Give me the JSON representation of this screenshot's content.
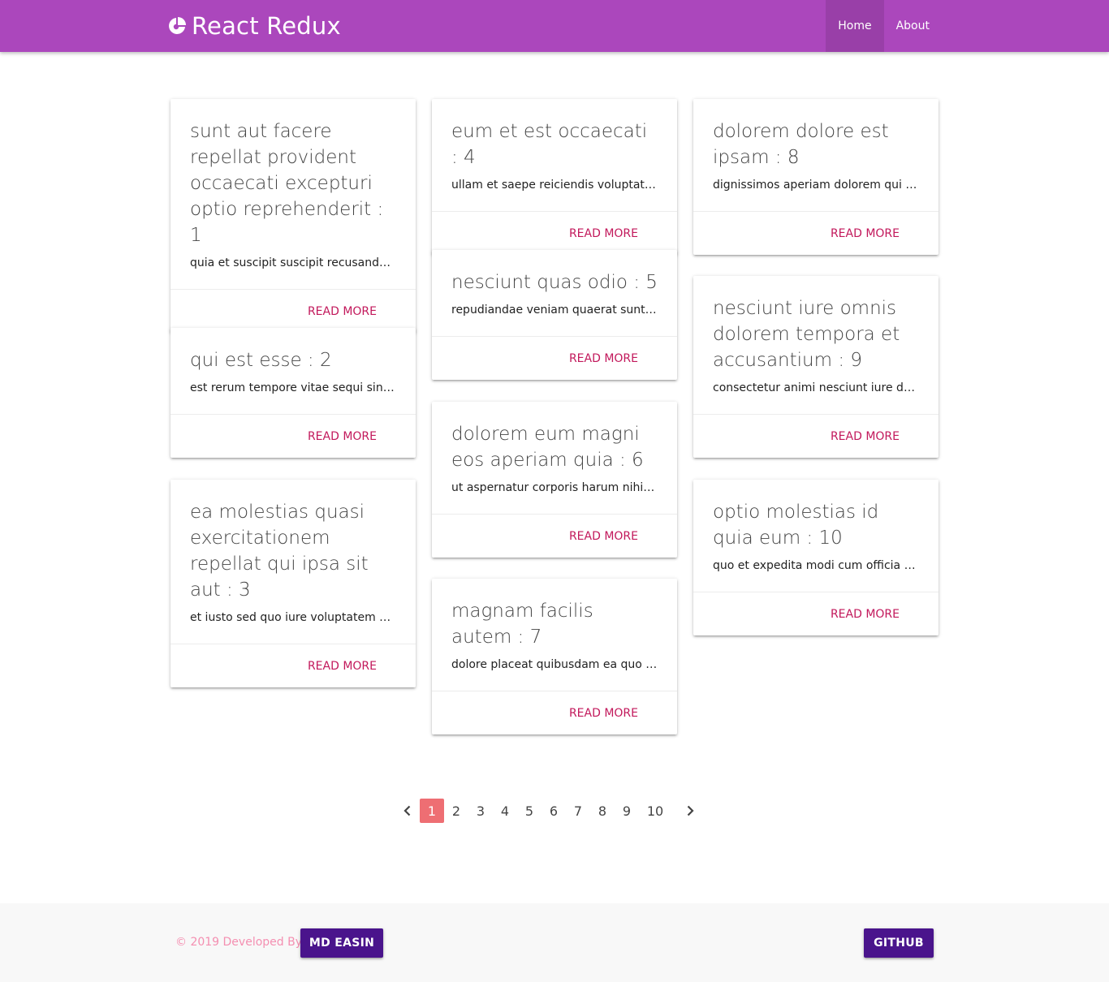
{
  "nav": {
    "brand": "React Redux",
    "brand_icon": "pie-chart-icon",
    "links": [
      {
        "label": "Home",
        "active": true
      },
      {
        "label": "About",
        "active": false
      }
    ]
  },
  "posts": [
    {
      "title": "sunt aut facere repellat provident occaecati excepturi optio reprehenderit : 1",
      "body": "quia et suscipit suscipit recusandae consequuntur expedita et cum reprehenderit molestiae ut ut quas totam nostrum rerum est autem sunt rem eveniet architecto",
      "action": "READ MORE"
    },
    {
      "title": "qui est esse : 2",
      "body": "est rerum tempore vitae sequi sint nihil reprehenderit dolor beatae ea dolores neque fugiat blanditiis voluptate porro vel nihil molestiae ut reiciendis",
      "action": "READ MORE"
    },
    {
      "title": "ea molestias quasi exercitationem repellat qui ipsa sit aut : 3",
      "body": "et iusto sed quo iure voluptatem occaecati omnis eligendi aut ad voluptatem doloribus vel accusantium quis pariatur",
      "action": "READ MORE"
    },
    {
      "title": "eum et est occaecati : 4",
      "body": "ullam et saepe reiciendis voluptatem adipisci sit amet autem assumenda provident rerum culpa",
      "action": "READ MORE"
    },
    {
      "title": "nesciunt quas odio : 5",
      "body": "repudiandae veniam quaerat sunt sed alias aut fugiat sit autem sed est voluptatem omnis possimus esse voluptatibus quis",
      "action": "READ MORE"
    },
    {
      "title": "dolorem eum magni eos aperiam quia : 6",
      "body": "ut aspernatur corporis harum nihil quis provident sequi mollitia nobis aliquid molestiae",
      "action": "READ MORE"
    },
    {
      "title": "magnam facilis autem : 7",
      "body": "dolore placeat quibusdam ea quo vitae magni quis enim qui quis quo nemo aut saepe",
      "action": "READ MORE"
    },
    {
      "title": "dolorem dolore est ipsam : 8",
      "body": "dignissimos aperiam dolorem qui eum facilis quibusdam animi sint suscipit qui sint possimus cum",
      "action": "READ MORE"
    },
    {
      "title": "nesciunt iure omnis dolorem tempora et accusantium : 9",
      "body": "consectetur animi nesciunt iure dolore enim quia ad veniam autem ut quam aut nobis",
      "action": "READ MORE"
    },
    {
      "title": "optio molestias id quia eum : 10",
      "body": "quo et expedita modi cum officia vel magni doloribus qui repudiandae vero nisi sit",
      "action": "READ MORE"
    }
  ],
  "pagination": {
    "prev_icon": "chevron-left-icon",
    "next_icon": "chevron-right-icon",
    "pages": [
      "1",
      "2",
      "3",
      "4",
      "5",
      "6",
      "7",
      "8",
      "9",
      "10"
    ],
    "current": "1"
  },
  "footer": {
    "copyright": "© 2019 Developed By",
    "author_button": "MD EASIN",
    "github_button": "GITHUB"
  },
  "colors": {
    "navbar": "#ab47bc",
    "accent_link": "#c2185b",
    "page_active": "#ee6e73",
    "footer_button": "#4a148c",
    "copyright_text": "#f48fb1"
  }
}
